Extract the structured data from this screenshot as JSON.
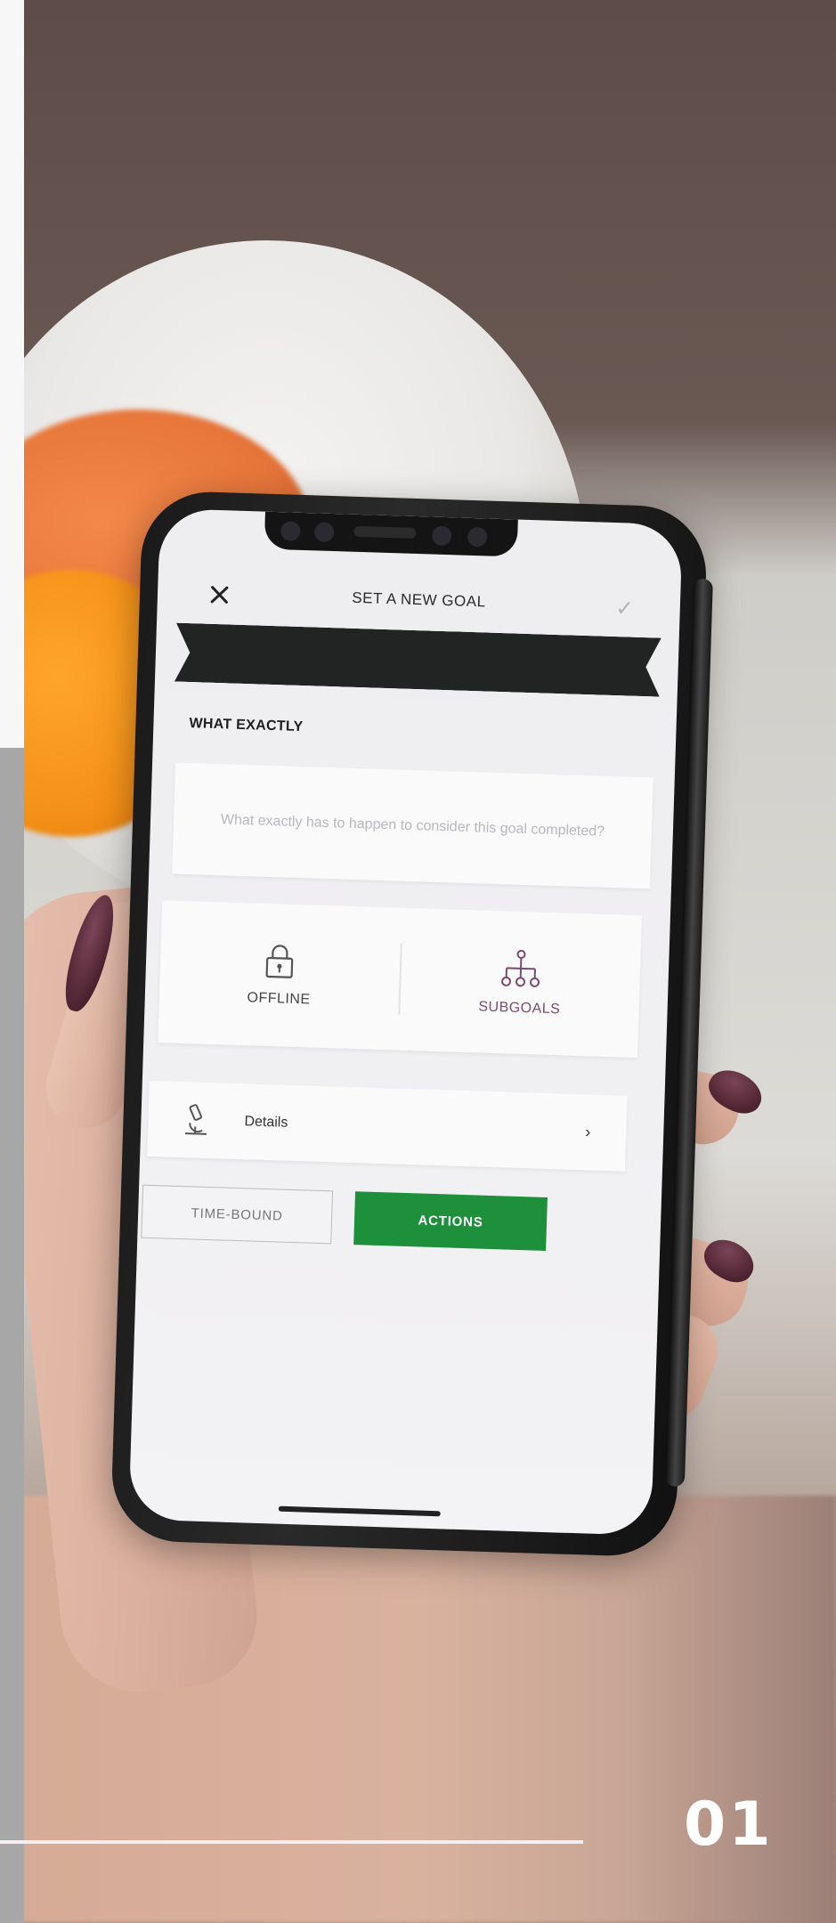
{
  "app": {
    "title": "SET A NEW GOAL",
    "close_icon": "close-icon",
    "confirm_icon": "check-icon"
  },
  "section": {
    "label": "WHAT EXACTLY"
  },
  "goal_input": {
    "placeholder": "What exactly has to happen to consider this goal completed?"
  },
  "toggles": [
    {
      "label": "OFFLINE",
      "icon": "lock-icon"
    },
    {
      "label": "SUBGOALS",
      "icon": "hierarchy-icon"
    }
  ],
  "details": {
    "label": "Details",
    "icon": "microscope-icon",
    "chevron": "›"
  },
  "buttons": {
    "time_bound": "TIME-BOUND",
    "actions": "ACTIONS"
  },
  "page": {
    "number": "01"
  },
  "colors": {
    "accent_green": "#1e8f3b",
    "subgoals_purple": "#7a4b6c",
    "banner": "#222423"
  }
}
